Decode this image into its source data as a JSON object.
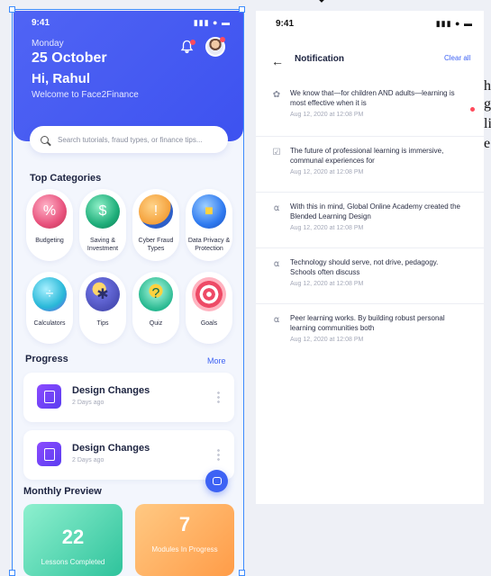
{
  "canvas": {
    "bg_glyphs": [
      "h",
      "g",
      "li",
      "e"
    ]
  },
  "home": {
    "status_time": "9:41",
    "day": "Monday",
    "date": "25 October",
    "greeting": "Hi, Rahul",
    "welcome": "Welcome to Face2Finance",
    "search_placeholder": "Search tutorials, fraud types, or finance tips...",
    "categories_title": "Top Categories",
    "categories": [
      {
        "label": "Budgeting",
        "icon": "budget-icon",
        "color": "#e8517c",
        "glyph": "%"
      },
      {
        "label": "Saving & Investment",
        "icon": "money-jar-icon",
        "color": "#1fae7a",
        "glyph": "$"
      },
      {
        "label": "Cyber Fraud Types",
        "icon": "phone-hacker-icon",
        "color": "#f4a03a",
        "glyph": "!"
      },
      {
        "label": "Data Privacy & Protection",
        "icon": "shield-lock-icon",
        "color": "#2f7af0",
        "glyph": "■"
      },
      {
        "label": "Calculators",
        "icon": "calculator-icon",
        "color": "#28b8d8",
        "glyph": "÷"
      },
      {
        "label": "Tips",
        "icon": "lightbulb-icon",
        "color": "#4b4fb8",
        "glyph": "✱"
      },
      {
        "label": "Quiz",
        "icon": "quiz-bulb-icon",
        "color": "#27b890",
        "glyph": "?"
      },
      {
        "label": "Goals",
        "icon": "target-icon",
        "color": "#ee4a66",
        "glyph": "◎"
      }
    ],
    "progress_title": "Progress",
    "progress_more": "More",
    "progress_items": [
      {
        "title": "Design Changes",
        "subtitle": "2 Days ago"
      },
      {
        "title": "Design Changes",
        "subtitle": "2 Days ago"
      }
    ],
    "monthly_title": "Monthly Preview",
    "stats": [
      {
        "value": "22",
        "label": "Lessons Completed"
      },
      {
        "value": "7",
        "label": "Modules In Progress"
      }
    ]
  },
  "notifications": {
    "status_time": "9:41",
    "title": "Notification",
    "clear_all": "Clear all",
    "items": [
      {
        "icon": "badge-icon",
        "text": "We know that—for children AND adults—learning is most effective when it is",
        "time": "Aug 12, 2020 at 12:08 PM",
        "unread": true
      },
      {
        "icon": "calendar-check-icon",
        "text": "The future of professional learning is immersive, communal experiences for",
        "time": "Aug 12, 2020 at 12:08 PM",
        "unread": false
      },
      {
        "icon": "bell-icon",
        "text": "With this in mind, Global Online Academy created the Blended Learning Design",
        "time": "Aug 12, 2020 at 12:08 PM",
        "unread": false
      },
      {
        "icon": "bell-icon",
        "text": "Technology should serve, not drive, pedagogy. Schools often discuss",
        "time": "Aug 12, 2020 at 12:08 PM",
        "unread": false
      },
      {
        "icon": "bell-icon",
        "text": "Peer learning works. By building robust personal learning communities both",
        "time": "Aug 12, 2020 at 12:08 PM",
        "unread": false
      }
    ]
  }
}
